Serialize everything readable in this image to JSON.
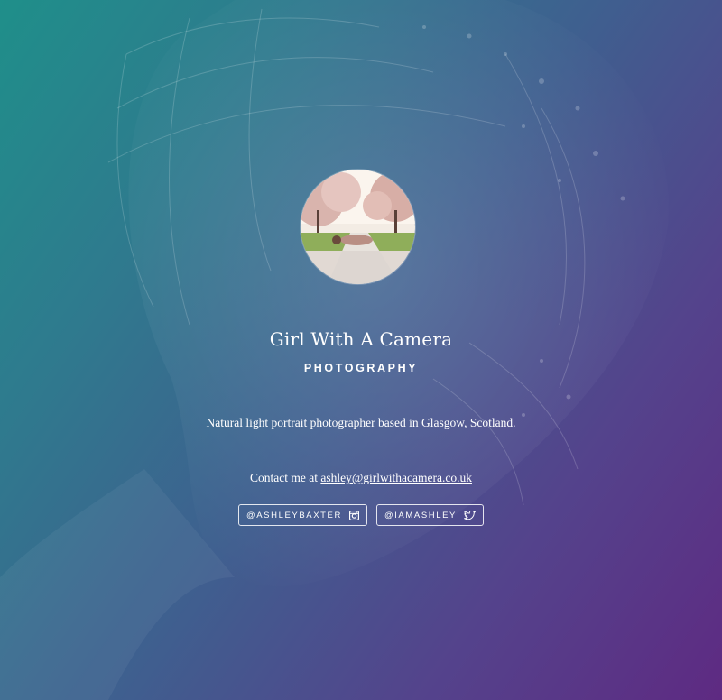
{
  "profile": {
    "name": "Girl With A Camera",
    "tagline": "PHOTOGRAPHY",
    "bio": "Natural light portrait photographer based in Glasgow, Scotland.",
    "contact_prefix": "Contact me at ",
    "email": "ashley@girlwithacamera.co.uk",
    "avatar_icon": "avatar-photo"
  },
  "socials": [
    {
      "label": "@ASHLEYBAXTER",
      "icon": "instagram-icon"
    },
    {
      "label": "@IAMASHLEY",
      "icon": "twitter-icon"
    }
  ],
  "colors": {
    "gradient_start": "#1f8f8a",
    "gradient_end": "#5e2a82",
    "text": "#ffffff"
  }
}
